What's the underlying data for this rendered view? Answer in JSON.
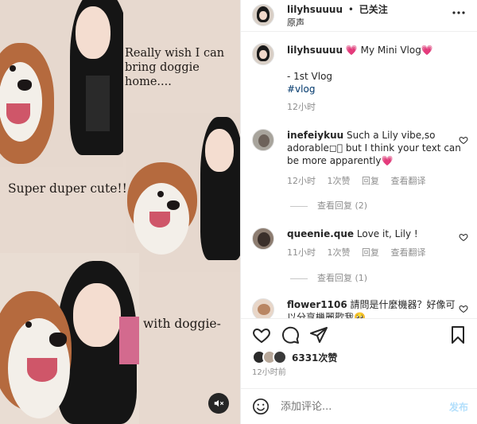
{
  "media": {
    "caption1": "Really wish I can bring doggie home....",
    "caption2": "Super duper cute!!",
    "caption3": "with doggie-",
    "mute_icon": "speaker-muted-icon"
  },
  "header": {
    "username": "lilyhsuuuu",
    "separator": "•",
    "follow_status": "已关注",
    "subtitle": "原声",
    "more_icon": "more-horizontal-icon"
  },
  "post": {
    "username": "lilyhsuuuu",
    "text": "💗 My Mini Vlog💗",
    "line2": "- 1st Vlog",
    "hashtag": "#vlog",
    "time": "12小时"
  },
  "comments": [
    {
      "username": "inefeiykuu",
      "text": "Such a Lily vibe,so adorable◻🏻 but I think your text can be more apparently💗",
      "time": "12小时",
      "likes": "1次赞",
      "reply": "回复",
      "translate": "查看翻译",
      "view_replies": "查看回复 (2)"
    },
    {
      "username": "queenie.que",
      "text": "Love it, Lily !",
      "time": "11小时",
      "likes": "1次赞",
      "reply": "回复",
      "translate": "查看翻译",
      "view_replies": "查看回复 (1)"
    },
    {
      "username": "flower1106",
      "text": "請問是什麼機器？好像可以分享機麗歡我🥺"
    }
  ],
  "actions": {
    "like_icon": "heart-icon",
    "comment_icon": "comment-icon",
    "share_icon": "send-icon",
    "save_icon": "bookmark-icon"
  },
  "likes": {
    "count_text": "6331次赞",
    "time": "12小时前"
  },
  "comment_box": {
    "emoji_icon": "emoji-icon",
    "placeholder": "添加评论...",
    "post_label": "发布"
  },
  "colors": {
    "background_beige": "#e7d9cf",
    "link_blue": "#00376b",
    "post_button_blue": "#b2dffc",
    "secondary_text": "#8e8e8e"
  }
}
